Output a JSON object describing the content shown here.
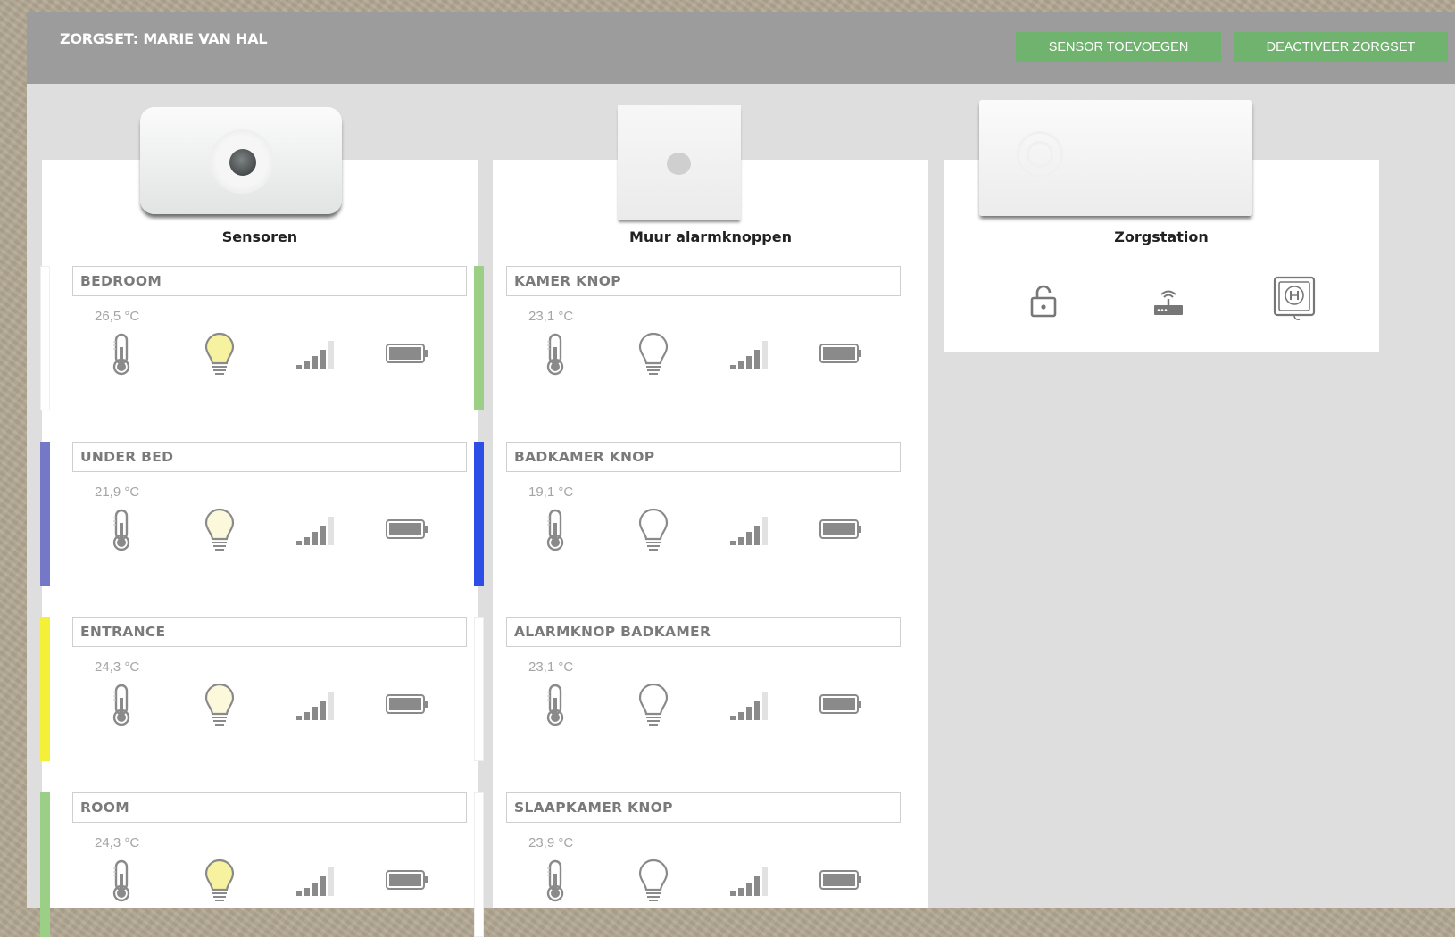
{
  "header": {
    "title": "ZORGSET: MARIE VAN HAL",
    "add_sensor_label": "SENSOR TOEVOEGEN",
    "deactivate_label": "DEACTIVEER ZORGSET"
  },
  "columns": {
    "sensors": {
      "title": "Sensoren",
      "items": [
        {
          "name": "BEDROOM",
          "temp": "26,5 °C",
          "color": "#ffffff",
          "light": "on"
        },
        {
          "name": "UNDER BED",
          "temp": "21,9 °C",
          "color": "#7478c6",
          "light": "dim"
        },
        {
          "name": "ENTRANCE",
          "temp": "24,3 °C",
          "color": "#f4f03a",
          "light": "dim"
        },
        {
          "name": "ROOM",
          "temp": "24,3 °C",
          "color": "#9ccf86",
          "light": "on"
        }
      ]
    },
    "buttons": {
      "title": "Muur alarmknoppen",
      "items": [
        {
          "name": "KAMER KNOP",
          "temp": "23,1 °C",
          "color": "#9ccf86",
          "light": "off"
        },
        {
          "name": "BADKAMER KNOP",
          "temp": "19,1 °C",
          "color": "#2c4ee6",
          "light": "off"
        },
        {
          "name": "ALARMKNOP BADKAMER",
          "temp": "23,1 °C",
          "color": "#ffffff",
          "light": "off"
        },
        {
          "name": "SLAAPKAMER KNOP",
          "temp": "23,9 °C",
          "color": "#ffffff",
          "light": "off"
        }
      ]
    },
    "station": {
      "title": "Zorgstation",
      "icons": [
        "lock-open-icon",
        "router-icon",
        "power-socket-icon"
      ]
    }
  },
  "colors": {
    "header_bg": "#9c9c9c",
    "button_bg": "#6fb36e",
    "panel_bg": "#dedede",
    "icon_gray": "#8a8a8a"
  }
}
